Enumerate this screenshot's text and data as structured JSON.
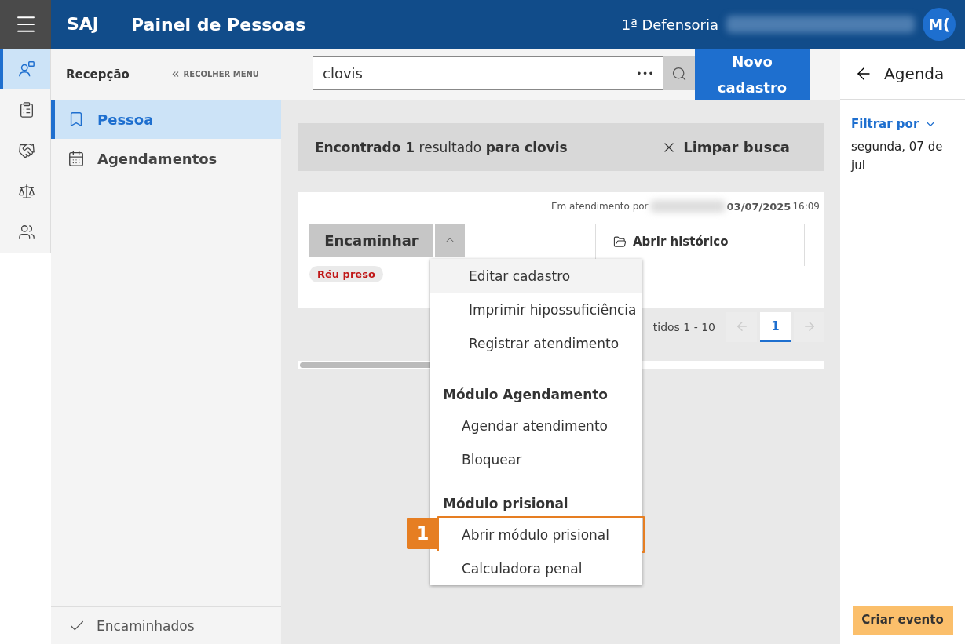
{
  "header": {
    "logo": "SAJ",
    "title": "Painel de Pessoas",
    "office": "1ª Defensoria",
    "avatar": "M("
  },
  "rail": [
    {
      "selected": true
    },
    {
      "selected": false
    },
    {
      "selected": false
    },
    {
      "selected": false
    },
    {
      "selected": false
    }
  ],
  "sidebar": {
    "title": "Recepção",
    "collapse": "RECOLHER MENU",
    "items": [
      {
        "label": "Pessoa",
        "selected": true
      },
      {
        "label": "Agendamentos",
        "selected": false
      }
    ],
    "footer": "Encaminhados"
  },
  "search": {
    "value": "clovis",
    "more": "•••",
    "new_button": [
      "Novo",
      "cadastro"
    ]
  },
  "result_bar": {
    "text": "**Encontrado 1** resultado **para clovis**",
    "clear": "Limpar busca"
  },
  "card": {
    "attending_label": "Em atendimento por",
    "date": "03/07/2025",
    "time": "16:09",
    "forward": "Encaminhar",
    "tag": "Réu preso",
    "history": "Abrir histórico"
  },
  "pagination": {
    "range": "tidos 1 - 10",
    "pages": [
      {
        "label": "1",
        "selected": true
      }
    ]
  },
  "menu": [
    {
      "kind": "item",
      "label": "Editar cadastro",
      "highlighted": true
    },
    {
      "kind": "item",
      "label": "Imprimir hipossuficiência",
      "highlighted": false
    },
    {
      "kind": "item",
      "label": "Registrar atendimento",
      "highlighted": false
    },
    {
      "kind": "header",
      "label": "Módulo Agendamento"
    },
    {
      "kind": "subitem",
      "label": "Agendar atendimento",
      "highlighted": false
    },
    {
      "kind": "subitem",
      "label": "Bloquear",
      "highlighted": false
    },
    {
      "kind": "header",
      "label": "Módulo prisional"
    },
    {
      "kind": "subitem",
      "label": "Abrir módulo prisional",
      "highlighted": false,
      "callout": "1"
    },
    {
      "kind": "subitem",
      "label": "Calculadora penal",
      "highlighted": false
    }
  ],
  "agenda": {
    "title": "Agenda",
    "filter": "Filtrar por",
    "date": "segunda, 07 de jul",
    "create": "Criar evento"
  }
}
